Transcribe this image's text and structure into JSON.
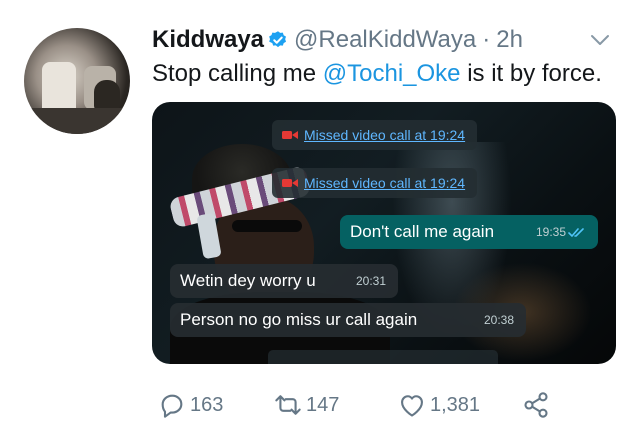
{
  "tweet": {
    "display_name": "Kiddwaya",
    "handle": "@RealKiddWaya",
    "separator": "·",
    "time": "2h",
    "text_before": "Stop calling me ",
    "mention": "@Tochi_Oke",
    "text_after": " is it by force."
  },
  "chat": {
    "missed_1": "Missed video call at 19:24",
    "missed_2": "Missed video call at 19:24",
    "messages": [
      {
        "text": "Don't call me again",
        "time": "19:35",
        "direction": "outgoing"
      },
      {
        "text": "Wetin dey worry u",
        "time": "20:31",
        "direction": "incoming"
      },
      {
        "text": "Person no go miss ur call again",
        "time": "20:38",
        "direction": "incoming"
      }
    ]
  },
  "actions": {
    "replies": "163",
    "retweets": "147",
    "likes": "1,381"
  },
  "colors": {
    "verified": "#1da1f2",
    "mention": "#1b95e0",
    "muted": "#657786",
    "outgoing_bubble": "#056162"
  },
  "icons": [
    "verified-icon",
    "chevron-down-icon",
    "video-camera-icon",
    "double-check-icon",
    "reply-icon",
    "retweet-icon",
    "like-icon",
    "share-icon"
  ]
}
